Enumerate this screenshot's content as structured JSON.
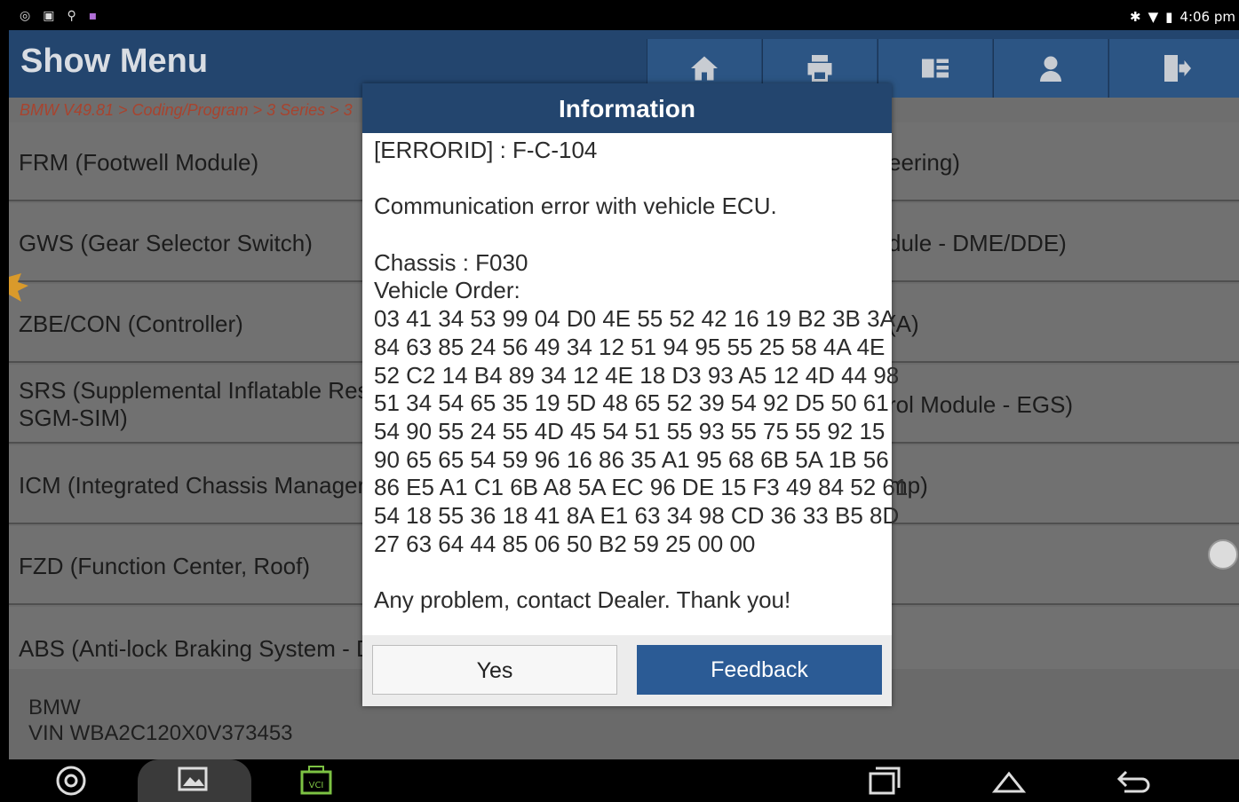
{
  "status_bar": {
    "time": "4:06 pm",
    "icons_left": [
      "chrome-icon",
      "image-icon",
      "usb-icon",
      "lock-icon"
    ],
    "icons_right": [
      "bluetooth-icon",
      "wifi-icon",
      "battery-icon"
    ]
  },
  "header": {
    "title": "Show Menu",
    "buttons": [
      "home-icon",
      "print-icon",
      "report-icon",
      "user-icon",
      "exit-icon"
    ]
  },
  "breadcrumb": "BMW V49.81 > Coding/Program > 3 Series > 3",
  "list_left": [
    "FRM (Footwell Module)",
    "GWS (Gear Selector Switch)",
    "ZBE/CON (Controller)",
    "SRS (Supplemental Inflatable Res",
    "SGM-SIM)",
    "ICM (Integrated Chassis Manager",
    "FZD (Function Center, Roof)",
    "ABS (Anti-lock Braking System - D"
  ],
  "list_right": [
    "eering)",
    "dule - DME/DDE)",
    "(A)",
    "rol Module - EGS)",
    "mp)"
  ],
  "vehicle": {
    "make": "BMW",
    "vin": "VIN WBA2C120X0V373453"
  },
  "dialog": {
    "title": "Information",
    "error_id": "[ERRORID] : F-C-104",
    "message": "Communication error with vehicle ECU.",
    "chassis": "Chassis : F030",
    "vehicle_order_label": "Vehicle Order:",
    "hex_lines": [
      "03 41 34 53 99 04 D0 4E 55 52 42 16 19 B2 3B 3A",
      "84 63 85 24 56 49 34 12 51 94 95 55 25 58 4A 4E",
      "52 C2 14 B4 89 34 12 4E 18 D3 93 A5 12 4D 44 98",
      "51 34 54 65 35 19 5D 48 65 52 39 54 92 D5 50 61",
      "54 90 55 24 55 4D 45 54 51 55 93 55 75 55 92 15",
      "90 65 65 54 59 96 16 86 35 A1 95 68 6B 5A 1B 56",
      "86 E5 A1 C1 6B A8 5A EC 96 DE 15 F3 49 84 52 61",
      "54 18 55 36 18 41 8A E1 63 34 98 CD 36 33 B5 8D",
      "27 63 64 44 85 06 50 B2 59 25 00 00"
    ],
    "footer_note": "Any problem, contact Dealer. Thank you!",
    "yes_label": "Yes",
    "feedback_label": "Feedback"
  },
  "nav_bar": {
    "vci_label": "VCI",
    "icons": [
      "chrome-icon",
      "gallery-icon",
      "vci-icon",
      "recent-apps-icon",
      "home-nav-icon",
      "back-icon"
    ]
  },
  "colors": {
    "header_bg": "#23456e",
    "breadcrumb_text": "#a8432e",
    "feedback_btn": "#2b5b95"
  }
}
